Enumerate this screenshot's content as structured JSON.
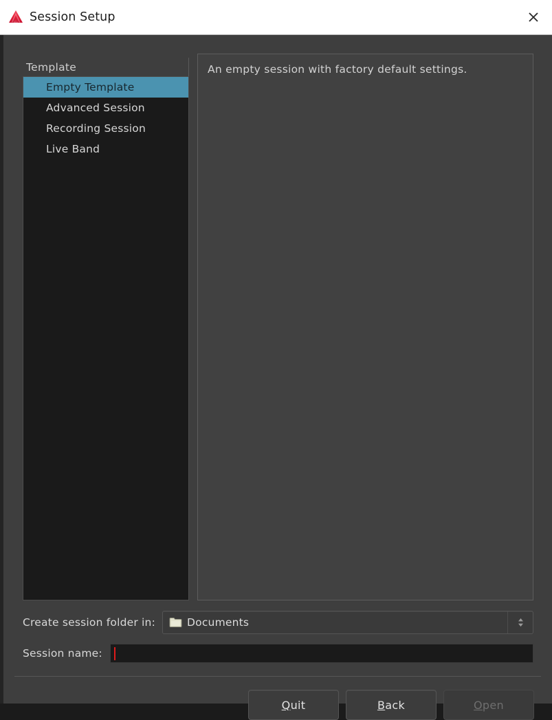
{
  "window": {
    "title": "Session Setup",
    "logo_icon": "ardour-logo-icon",
    "close_icon": "close-icon"
  },
  "template_panel": {
    "header": "Template",
    "items": [
      {
        "label": "Empty Template",
        "selected": true
      },
      {
        "label": "Advanced Session",
        "selected": false
      },
      {
        "label": "Recording Session",
        "selected": false
      },
      {
        "label": "Live Band",
        "selected": false
      }
    ]
  },
  "description_panel": {
    "text": "An empty session with factory default settings."
  },
  "folder_row": {
    "label": "Create session folder in:",
    "icon": "folder-icon",
    "value": "Documents",
    "spinner_icon": "spinner-up-down-icon"
  },
  "name_row": {
    "label": "Session name:",
    "value": "",
    "placeholder": ""
  },
  "buttons": [
    {
      "name": "quit-button",
      "mnemonic": "Q",
      "rest": "uit",
      "disabled": false
    },
    {
      "name": "back-button",
      "mnemonic": "B",
      "rest": "ack",
      "disabled": false
    },
    {
      "name": "open-button",
      "mnemonic": "O",
      "rest": "pen",
      "disabled": true
    }
  ],
  "colors": {
    "titlebar_bg": "#ffffff",
    "dialog_bg": "#3e3e3e",
    "list_bg": "#1a1a1a",
    "selection": "#4b93b0",
    "description_bg": "#414141",
    "input_bg": "#1a1a1a",
    "caret": "#e01b1b",
    "logo_red": "#e8253c"
  }
}
